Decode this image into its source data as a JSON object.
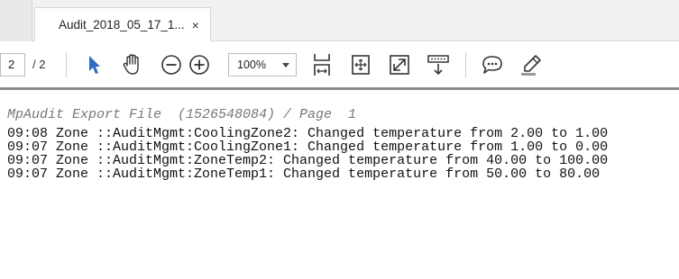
{
  "tab": {
    "title": "Audit_2018_05_17_1...",
    "close_glyph": "×"
  },
  "toolbar": {
    "page_current": "2",
    "page_total": "/ 2",
    "zoom": "100%",
    "icons": [
      "select-arrow-icon",
      "hand-pan-icon",
      "zoom-out-icon",
      "zoom-in-icon",
      "fit-page-icon",
      "rotate-page-icon",
      "full-screen-icon",
      "read-mode-icon",
      "comment-icon",
      "highlight-pen-icon"
    ],
    "accent_color": "#2d6cc0"
  },
  "document": {
    "header": "MpAudit Export File  (1526548084) / Page  1",
    "lines": [
      "09:08 Zone ::AuditMgmt:CoolingZone2: Changed temperature from 2.00 to 1.00",
      "09:07 Zone ::AuditMgmt:CoolingZone1: Changed temperature from 1.00 to 0.00",
      "09:07 Zone ::AuditMgmt:ZoneTemp2: Changed temperature from 40.00 to 100.00",
      "09:07 Zone ::AuditMgmt:ZoneTemp1: Changed temperature from 50.00 to 80.00"
    ]
  }
}
